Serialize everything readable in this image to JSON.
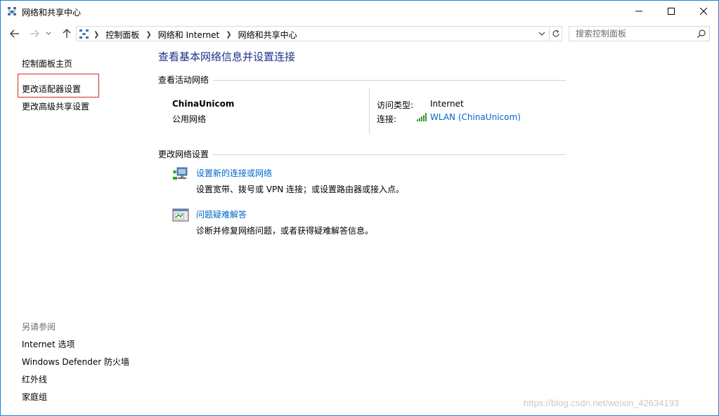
{
  "window": {
    "title": "网络和共享中心"
  },
  "nav": {
    "breadcrumbs": [
      "控制面板",
      "网络和 Internet",
      "网络和共享中心"
    ]
  },
  "search": {
    "placeholder": "搜索控制面板"
  },
  "sidebar": {
    "links": [
      "控制面板主页",
      "更改适配器设置",
      "更改高级共享设置"
    ],
    "see_also_label": "另请参阅",
    "see_also": [
      "Internet 选项",
      "Windows Defender 防火墙",
      "红外线",
      "家庭组"
    ]
  },
  "main": {
    "title": "查看基本网络信息并设置连接",
    "active_networks_header": "查看活动网络",
    "network": {
      "name": "ChinaUnicom",
      "category": "公用网络",
      "access_type_label": "访问类型:",
      "access_type_value": "Internet",
      "connection_label": "连接:",
      "connection_value": "WLAN (ChinaUnicom)"
    },
    "change_settings_header": "更改网络设置",
    "tasks": [
      {
        "title": "设置新的连接或网络",
        "description": "设置宽带、拨号或 VPN 连接；或设置路由器或接入点。"
      },
      {
        "title": "问题疑难解答",
        "description": "诊断并修复网络问题，或者获得疑难解答信息。"
      }
    ]
  },
  "watermark": "https://blog.csdn.net/weixin_42634193",
  "colors": {
    "link": "#0066cc",
    "title": "#1e3287",
    "window_border": "#1883d7",
    "highlight": "#d02a2a"
  }
}
